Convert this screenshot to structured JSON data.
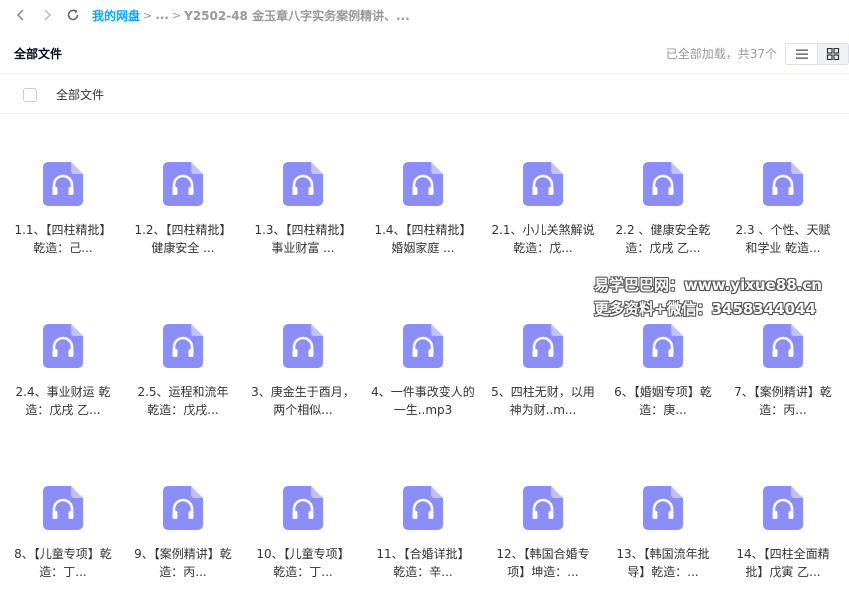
{
  "breadcrumb": {
    "root": "我的网盘",
    "ellipsis": "...",
    "current": "Y2502-48 金玉章八字实务案例精讲、..."
  },
  "header": {
    "title": "全部文件",
    "status": "已全部加载，共37个"
  },
  "list_header": {
    "label": "全部文件"
  },
  "colors": {
    "accent": "#06a7ff",
    "file_icon": "#8c8ef8"
  },
  "files": [
    {
      "name": "1.1、【四柱精批】乾造：己..."
    },
    {
      "name": "1.2、【四柱精批】健康安全 ..."
    },
    {
      "name": "1.3、【四柱精批】事业财富 ..."
    },
    {
      "name": "1.4、【四柱精批】婚姻家庭 ..."
    },
    {
      "name": "2.1、小儿关煞解说 乾造：戊..."
    },
    {
      "name": "2.2 、健康安全乾造：戊戌 乙..."
    },
    {
      "name": "2.3 、个性、天赋和学业 乾造..."
    },
    {
      "name": "2.4、事业财运 乾造：戊戌 乙..."
    },
    {
      "name": "2.5、运程和流年 乾造：戊戌..."
    },
    {
      "name": "3、庚金生于酉月，两个相似..."
    },
    {
      "name": "4、一件事改变人的一生..mp3"
    },
    {
      "name": "5、四柱无财，以用神为财..m..."
    },
    {
      "name": "6、【婚姻专项】乾造：庚..."
    },
    {
      "name": "7、【案例精讲】乾造：丙..."
    },
    {
      "name": "8、【儿童专项】乾造：丁..."
    },
    {
      "name": "9、【案例精讲】乾造：丙..."
    },
    {
      "name": "10、【儿童专项】乾造：丁..."
    },
    {
      "name": "11、【合婚详批】乾造：辛..."
    },
    {
      "name": "12、【韩国合婚专项】坤造：..."
    },
    {
      "name": "13、【韩国流年批导】乾造：..."
    },
    {
      "name": "14、【四柱全面精批】戊寅 乙..."
    }
  ],
  "watermark": {
    "line1": "易学巴巴网：www.yixue88.cn",
    "line2": "更多资料+微信：3458344044"
  }
}
